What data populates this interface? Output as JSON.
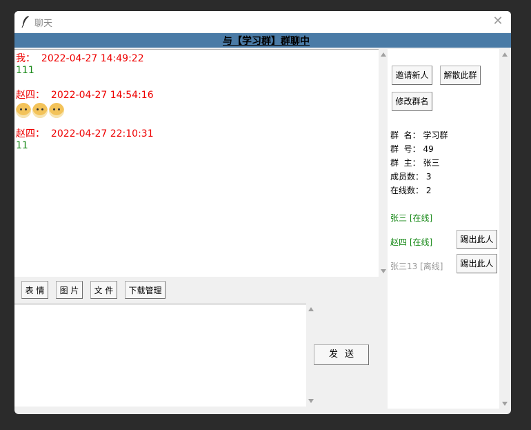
{
  "window": {
    "title": "聊天"
  },
  "banner": {
    "text": "与【学习群】群聊中"
  },
  "messages": [
    {
      "sender": "我：",
      "time": "2022-04-27 14:49:22",
      "text": "111"
    },
    {
      "sender": "赵四：",
      "time": "2022-04-27 14:54:16",
      "emoji_count": 3,
      "emoji": "dog-face-icon"
    },
    {
      "sender": "赵四：",
      "time": "2022-04-27 22:10:31",
      "text": "11"
    }
  ],
  "toolbar": {
    "emoji_label": "表 情",
    "image_label": "图 片",
    "file_label": "文 件",
    "download_label": "下载管理"
  },
  "input": {
    "value": ""
  },
  "send_label": "发送",
  "side": {
    "invite_label": "邀请新人",
    "dissolve_label": "解散此群",
    "rename_label": "修改群名",
    "info": {
      "name_label": "群  名：",
      "name_value": "学习群",
      "id_label": "群  号：",
      "id_value": "49",
      "owner_label": "群  主：",
      "owner_value": "张三",
      "members_label": "成员数：",
      "members_value": "3",
      "online_label": "在线数：",
      "online_value": "2"
    },
    "members": [
      {
        "label": "张三 [在线]",
        "status": "online"
      },
      {
        "label": "赵四 [在线]",
        "status": "online",
        "kick_label": "踢出此人"
      },
      {
        "label": "张三13 [离线]",
        "status": "offline",
        "kick_label": "踢出此人"
      }
    ]
  },
  "colors": {
    "banner": "#4a7ba6",
    "sender": "#e00000",
    "online": "#1a8a1a",
    "offline": "#999999"
  }
}
